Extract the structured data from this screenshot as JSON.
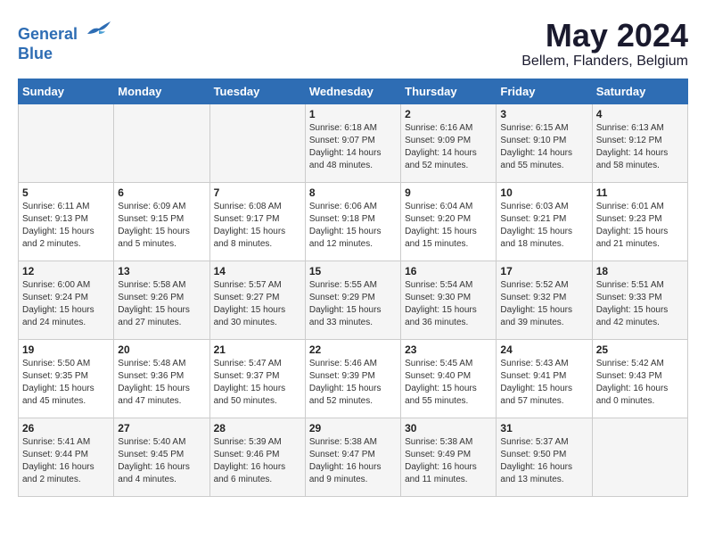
{
  "header": {
    "logo_line1": "General",
    "logo_line2": "Blue",
    "title": "May 2024",
    "subtitle": "Bellem, Flanders, Belgium"
  },
  "days_of_week": [
    "Sunday",
    "Monday",
    "Tuesday",
    "Wednesday",
    "Thursday",
    "Friday",
    "Saturday"
  ],
  "weeks": [
    [
      {
        "day": "",
        "info": ""
      },
      {
        "day": "",
        "info": ""
      },
      {
        "day": "",
        "info": ""
      },
      {
        "day": "1",
        "info": "Sunrise: 6:18 AM\nSunset: 9:07 PM\nDaylight: 14 hours\nand 48 minutes."
      },
      {
        "day": "2",
        "info": "Sunrise: 6:16 AM\nSunset: 9:09 PM\nDaylight: 14 hours\nand 52 minutes."
      },
      {
        "day": "3",
        "info": "Sunrise: 6:15 AM\nSunset: 9:10 PM\nDaylight: 14 hours\nand 55 minutes."
      },
      {
        "day": "4",
        "info": "Sunrise: 6:13 AM\nSunset: 9:12 PM\nDaylight: 14 hours\nand 58 minutes."
      }
    ],
    [
      {
        "day": "5",
        "info": "Sunrise: 6:11 AM\nSunset: 9:13 PM\nDaylight: 15 hours\nand 2 minutes."
      },
      {
        "day": "6",
        "info": "Sunrise: 6:09 AM\nSunset: 9:15 PM\nDaylight: 15 hours\nand 5 minutes."
      },
      {
        "day": "7",
        "info": "Sunrise: 6:08 AM\nSunset: 9:17 PM\nDaylight: 15 hours\nand 8 minutes."
      },
      {
        "day": "8",
        "info": "Sunrise: 6:06 AM\nSunset: 9:18 PM\nDaylight: 15 hours\nand 12 minutes."
      },
      {
        "day": "9",
        "info": "Sunrise: 6:04 AM\nSunset: 9:20 PM\nDaylight: 15 hours\nand 15 minutes."
      },
      {
        "day": "10",
        "info": "Sunrise: 6:03 AM\nSunset: 9:21 PM\nDaylight: 15 hours\nand 18 minutes."
      },
      {
        "day": "11",
        "info": "Sunrise: 6:01 AM\nSunset: 9:23 PM\nDaylight: 15 hours\nand 21 minutes."
      }
    ],
    [
      {
        "day": "12",
        "info": "Sunrise: 6:00 AM\nSunset: 9:24 PM\nDaylight: 15 hours\nand 24 minutes."
      },
      {
        "day": "13",
        "info": "Sunrise: 5:58 AM\nSunset: 9:26 PM\nDaylight: 15 hours\nand 27 minutes."
      },
      {
        "day": "14",
        "info": "Sunrise: 5:57 AM\nSunset: 9:27 PM\nDaylight: 15 hours\nand 30 minutes."
      },
      {
        "day": "15",
        "info": "Sunrise: 5:55 AM\nSunset: 9:29 PM\nDaylight: 15 hours\nand 33 minutes."
      },
      {
        "day": "16",
        "info": "Sunrise: 5:54 AM\nSunset: 9:30 PM\nDaylight: 15 hours\nand 36 minutes."
      },
      {
        "day": "17",
        "info": "Sunrise: 5:52 AM\nSunset: 9:32 PM\nDaylight: 15 hours\nand 39 minutes."
      },
      {
        "day": "18",
        "info": "Sunrise: 5:51 AM\nSunset: 9:33 PM\nDaylight: 15 hours\nand 42 minutes."
      }
    ],
    [
      {
        "day": "19",
        "info": "Sunrise: 5:50 AM\nSunset: 9:35 PM\nDaylight: 15 hours\nand 45 minutes."
      },
      {
        "day": "20",
        "info": "Sunrise: 5:48 AM\nSunset: 9:36 PM\nDaylight: 15 hours\nand 47 minutes."
      },
      {
        "day": "21",
        "info": "Sunrise: 5:47 AM\nSunset: 9:37 PM\nDaylight: 15 hours\nand 50 minutes."
      },
      {
        "day": "22",
        "info": "Sunrise: 5:46 AM\nSunset: 9:39 PM\nDaylight: 15 hours\nand 52 minutes."
      },
      {
        "day": "23",
        "info": "Sunrise: 5:45 AM\nSunset: 9:40 PM\nDaylight: 15 hours\nand 55 minutes."
      },
      {
        "day": "24",
        "info": "Sunrise: 5:43 AM\nSunset: 9:41 PM\nDaylight: 15 hours\nand 57 minutes."
      },
      {
        "day": "25",
        "info": "Sunrise: 5:42 AM\nSunset: 9:43 PM\nDaylight: 16 hours\nand 0 minutes."
      }
    ],
    [
      {
        "day": "26",
        "info": "Sunrise: 5:41 AM\nSunset: 9:44 PM\nDaylight: 16 hours\nand 2 minutes."
      },
      {
        "day": "27",
        "info": "Sunrise: 5:40 AM\nSunset: 9:45 PM\nDaylight: 16 hours\nand 4 minutes."
      },
      {
        "day": "28",
        "info": "Sunrise: 5:39 AM\nSunset: 9:46 PM\nDaylight: 16 hours\nand 6 minutes."
      },
      {
        "day": "29",
        "info": "Sunrise: 5:38 AM\nSunset: 9:47 PM\nDaylight: 16 hours\nand 9 minutes."
      },
      {
        "day": "30",
        "info": "Sunrise: 5:38 AM\nSunset: 9:49 PM\nDaylight: 16 hours\nand 11 minutes."
      },
      {
        "day": "31",
        "info": "Sunrise: 5:37 AM\nSunset: 9:50 PM\nDaylight: 16 hours\nand 13 minutes."
      },
      {
        "day": "",
        "info": ""
      }
    ]
  ]
}
